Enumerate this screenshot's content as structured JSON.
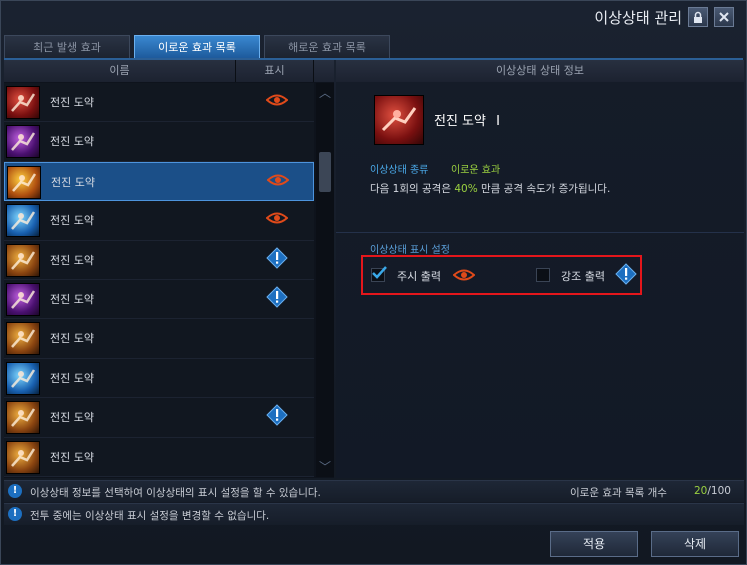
{
  "window": {
    "title": "이상상태 관리",
    "lock_icon": "lock-icon",
    "close_icon": "close-icon"
  },
  "tabs": [
    {
      "label": "최근 발생 효과",
      "active": false
    },
    {
      "label": "이로운 효과 목록",
      "active": true
    },
    {
      "label": "해로운 효과 목록",
      "active": false
    }
  ],
  "list": {
    "headers": {
      "name": "이름",
      "display": "표시"
    },
    "rows": [
      {
        "name": "전진 도약",
        "icon": "red-skill-icon",
        "indicator": "eye"
      },
      {
        "name": "전진 도약",
        "icon": "purple-skill-icon",
        "indicator": ""
      },
      {
        "name": "전진 도약",
        "icon": "yellow-skill-icon",
        "indicator": "eye",
        "selected": true
      },
      {
        "name": "전진 도약",
        "icon": "blue-skill-icon",
        "indicator": "eye"
      },
      {
        "name": "전진 도약",
        "icon": "orange-skill-icon",
        "indicator": "exclaim"
      },
      {
        "name": "전진 도약",
        "icon": "purple-skill-icon",
        "indicator": "exclaim"
      },
      {
        "name": "전진 도약",
        "icon": "orange-skill-icon",
        "indicator": ""
      },
      {
        "name": "전진 도약",
        "icon": "blue-skill-icon",
        "indicator": ""
      },
      {
        "name": "전진 도약",
        "icon": "orange-skill-icon",
        "indicator": "exclaim"
      },
      {
        "name": "전진 도약",
        "icon": "orange-skill-icon",
        "indicator": ""
      }
    ]
  },
  "info": {
    "header": "이상상태 상태 정보",
    "skill_name": "전진 도약",
    "skill_level": "I",
    "category_label": "이상상태 종류",
    "category_value": "이로운 효과",
    "desc_before": "다음 1회의 공격은 ",
    "desc_highlight": "40%",
    "desc_after": " 만큼 공격 속도가 증가됩니다.",
    "display_settings_label": "이상상태 표시 설정",
    "watch_label": "주시 출력",
    "watch_checked": true,
    "emphasis_label": "강조 출력",
    "emphasis_checked": false
  },
  "footer": {
    "hint1": "이상상태 정보를 선택하여 이상상태의 표시 설정을 할 수 있습니다.",
    "count_label": "이로운 효과 목록 개수",
    "count_current": "20",
    "count_total": "/100",
    "hint2": "전투 중에는 이상상태 표시 설정을 변경할 수 없습니다.",
    "apply_label": "적용",
    "delete_label": "삭제"
  },
  "colors": {
    "accent": "#1d5a9c",
    "highlight": "#9ad040",
    "alert": "#e4161b",
    "eye": "#e04a1a",
    "exclaim": "#3a8ad8"
  }
}
